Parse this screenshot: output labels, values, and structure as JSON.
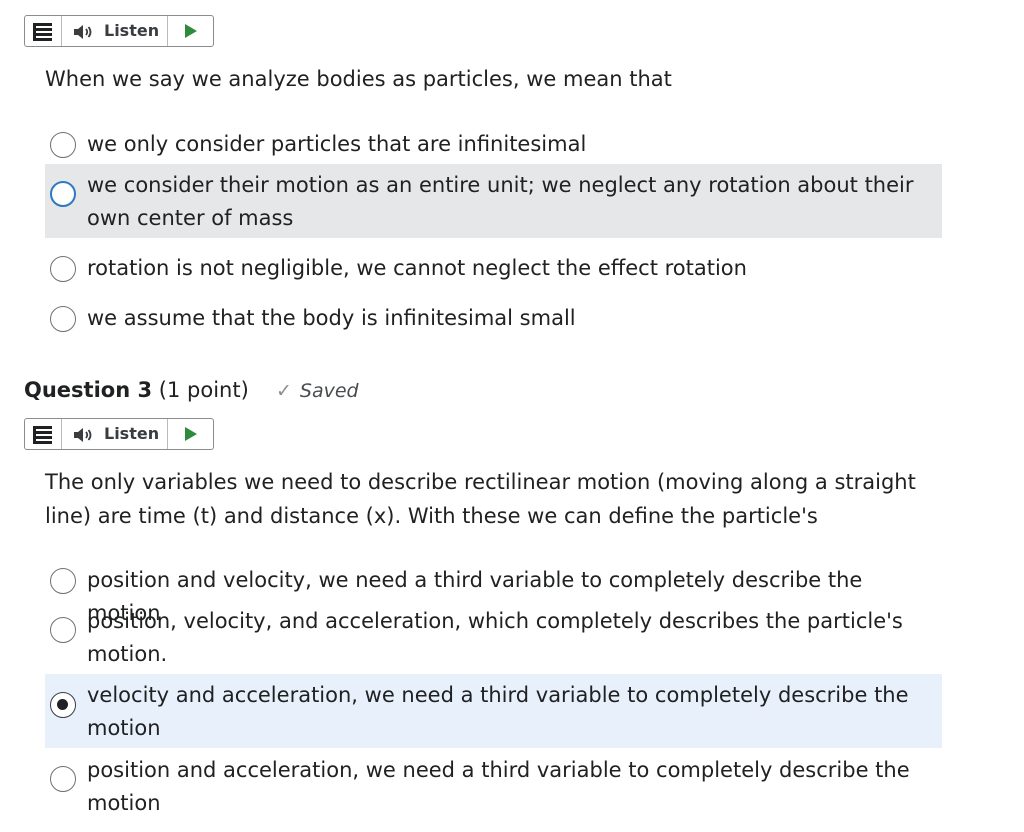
{
  "q2": {
    "listen_label": "Listen",
    "prompt": "When we say we analyze bodies as particles, we mean that",
    "options": [
      {
        "label": "we only consider particles that are infinitesimal"
      },
      {
        "label": "we consider their motion as an entire unit; we neglect any rotation about their own center of mass"
      },
      {
        "label": "rotation is not negligible, we cannot neglect the effect rotation"
      },
      {
        "label": "we assume that the body is infinitesimal small"
      }
    ]
  },
  "q3": {
    "title": "Question 3",
    "points": "(1 point)",
    "saved": "Saved",
    "listen_label": "Listen",
    "prompt": "The only variables we need to describe rectilinear motion (moving along a straight line) are time (t) and distance (x). With these we can define the particle's",
    "options": [
      {
        "label": "position and velocity, we need a third variable to completely describe the motion"
      },
      {
        "label": "position, velocity, and acceleration, which completely describes the particle's motion."
      },
      {
        "label": "velocity and acceleration, we need a third variable to completely describe the motion"
      },
      {
        "label": "position and acceleration, we need a third variable to completely describe the motion"
      }
    ],
    "selected_index": 2
  },
  "colors": {
    "hover_bg": "#e6e7e8",
    "selected_bg": "#e8f1fb",
    "focus_ring": "#2f78c4",
    "play_green": "#2e8b3c"
  },
  "icons": [
    "menu-icon",
    "speaker-icon",
    "play-icon",
    "checkmark-icon",
    "radio-button-icon"
  ]
}
